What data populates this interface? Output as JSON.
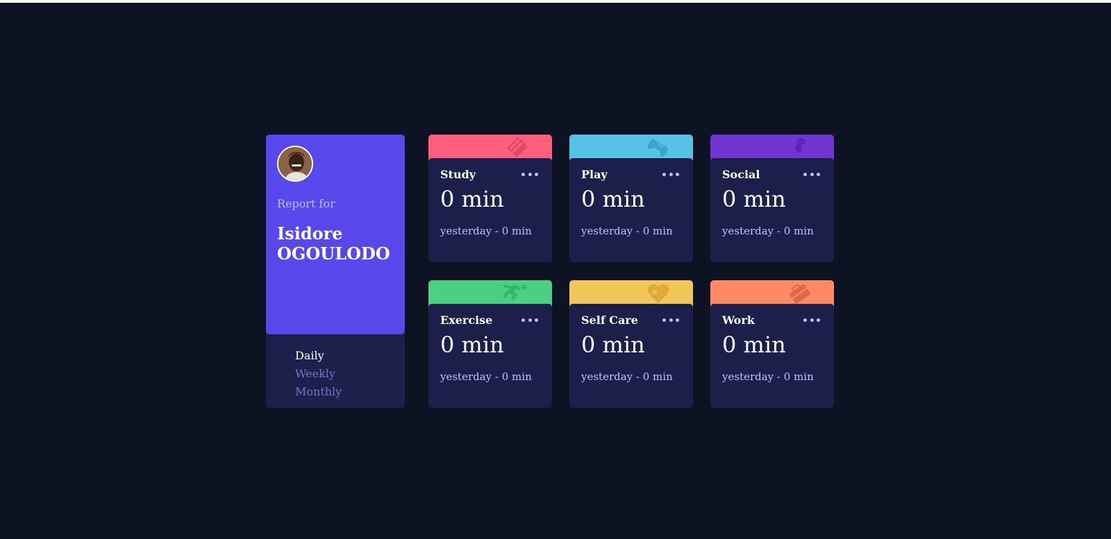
{
  "profile": {
    "report_label": "Report for",
    "name": "Isidore OGOULODO",
    "periods": [
      "Daily",
      "Weekly",
      "Monthly"
    ],
    "active_period": "Daily"
  },
  "activities": [
    {
      "title": "Study",
      "current": "0 min",
      "previous": "yesterday - 0 min",
      "color": "#ff5e7d",
      "icon": "book-icon"
    },
    {
      "title": "Play",
      "current": "0 min",
      "previous": "yesterday - 0 min",
      "color": "#55c2e6",
      "icon": "gamepad-icon"
    },
    {
      "title": "Social",
      "current": "0 min",
      "previous": "yesterday - 0 min",
      "color": "#7335d2",
      "icon": "chat-bubbles-icon"
    },
    {
      "title": "Exercise",
      "current": "0 min",
      "previous": "yesterday - 0 min",
      "color": "#4bcf82",
      "icon": "runner-icon"
    },
    {
      "title": "Self Care",
      "current": "0 min",
      "previous": "yesterday - 0 min",
      "color": "#f1c75b",
      "icon": "heart-icon"
    },
    {
      "title": "Work",
      "current": "0 min",
      "previous": "yesterday - 0 min",
      "color": "#ff8b64",
      "icon": "briefcase-icon"
    }
  ],
  "colors": {
    "background": "#0e1323",
    "profile": "#5847eb",
    "card": "#1c1f4a"
  }
}
